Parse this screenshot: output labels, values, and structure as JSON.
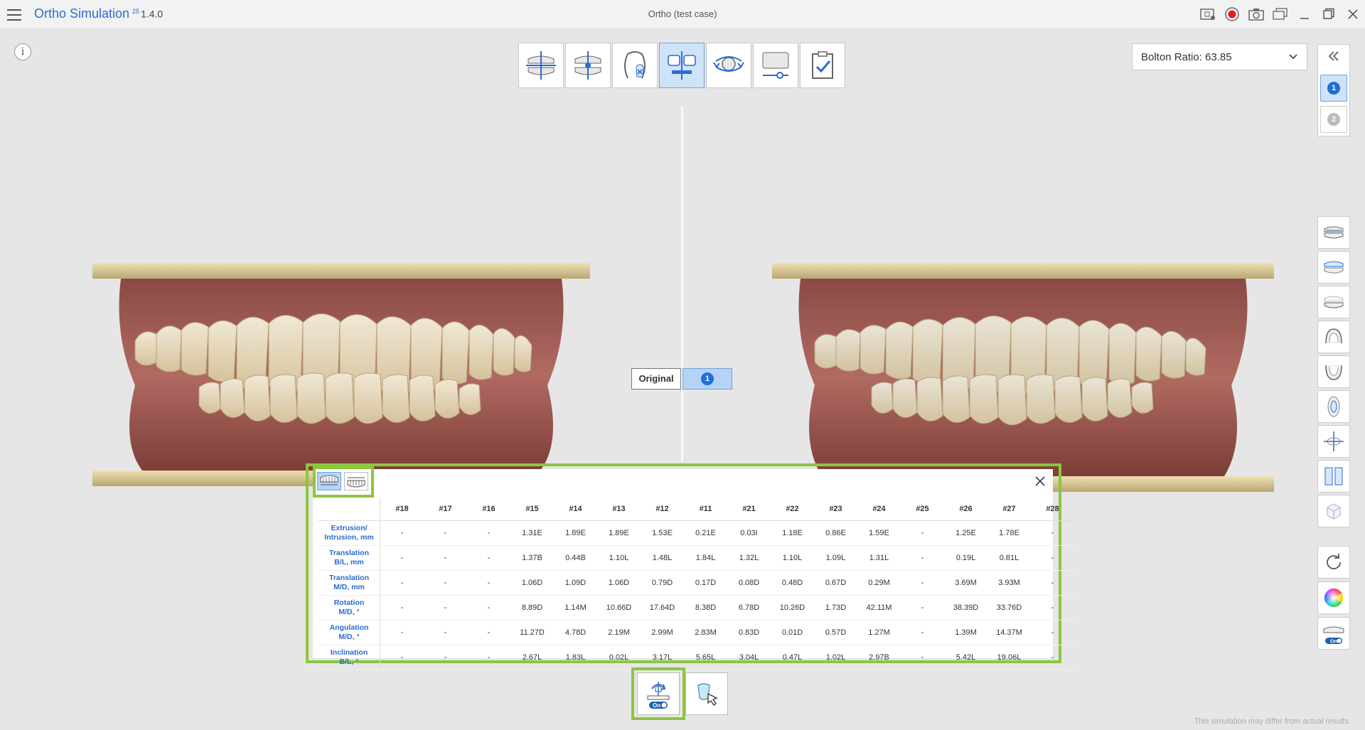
{
  "app": {
    "title": "Ortho Simulation",
    "version": "1.4.0",
    "version_badge": "25",
    "case_title": "Ortho (test case)"
  },
  "toolbar_top": {
    "steps": [
      "arch-alignment",
      "midline",
      "tooth-removal",
      "simulation",
      "rotate-view",
      "settings-slider",
      "report-check"
    ],
    "active_step": 3
  },
  "bolton": {
    "label": "Bolton Ratio: 63.85"
  },
  "stages": {
    "stage_1": "1",
    "stage_2": "2"
  },
  "compare": {
    "original_label": "Original",
    "stage_label": "1"
  },
  "table": {
    "teeth": [
      "#18",
      "#17",
      "#16",
      "#15",
      "#14",
      "#13",
      "#12",
      "#11",
      "#21",
      "#22",
      "#23",
      "#24",
      "#25",
      "#26",
      "#27",
      "#28"
    ],
    "rows": [
      {
        "label_1": "Extrusion/",
        "label_2": "Intrusion, mm",
        "values": [
          "-",
          "-",
          "-",
          "1.31E",
          "1.89E",
          "1.89E",
          "1.53E",
          "0.21E",
          "0.03I",
          "1.18E",
          "0.86E",
          "1.59E",
          "-",
          "1.25E",
          "1.78E",
          "-"
        ]
      },
      {
        "label_1": "Translation",
        "label_2": "B/L, mm",
        "values": [
          "-",
          "-",
          "-",
          "1.37B",
          "0.44B",
          "1.10L",
          "1.48L",
          "1.84L",
          "1.32L",
          "1.10L",
          "1.09L",
          "1.31L",
          "-",
          "0.19L",
          "0.81L",
          "-"
        ]
      },
      {
        "label_1": "Translation",
        "label_2": "M/D, mm",
        "values": [
          "-",
          "-",
          "-",
          "1.06D",
          "1.09D",
          "1.06D",
          "0.79D",
          "0.17D",
          "0.08D",
          "0.48D",
          "0.67D",
          "0.29M",
          "-",
          "3.69M",
          "3.93M",
          "-"
        ]
      },
      {
        "label_1": "Rotation",
        "label_2": "M/D, °",
        "values": [
          "-",
          "-",
          "-",
          "8.89D",
          "1.14M",
          "10.66D",
          "17.64D",
          "8.38D",
          "6.78D",
          "10.26D",
          "1.73D",
          "42.11M",
          "-",
          "38.39D",
          "33.76D",
          "-"
        ]
      },
      {
        "label_1": "Angulation",
        "label_2": "M/D, °",
        "values": [
          "-",
          "-",
          "-",
          "11.27D",
          "4.78D",
          "2.19M",
          "2.99M",
          "2.83M",
          "0.83D",
          "0.01D",
          "0.57D",
          "1.27M",
          "-",
          "1.39M",
          "14.37M",
          "-"
        ]
      },
      {
        "label_1": "Inclination",
        "label_2": "B/L, °",
        "values": [
          "-",
          "-",
          "-",
          "2.67L",
          "1.83L",
          "0.02L",
          "3.17L",
          "5.65L",
          "3.04L",
          "0.47L",
          "1.02L",
          "2.97B",
          "-",
          "5.42L",
          "19.06L",
          "-"
        ]
      }
    ]
  },
  "bottom": {
    "toggle_label": "On"
  },
  "side_toggle": {
    "label": "On"
  },
  "disclaimer": "This simulation may differ from actual results.",
  "colors": {
    "accent": "#2a6bd1",
    "highlight": "#8cc63f",
    "active_bg": "#cfe3f8",
    "record": "#e02020"
  }
}
